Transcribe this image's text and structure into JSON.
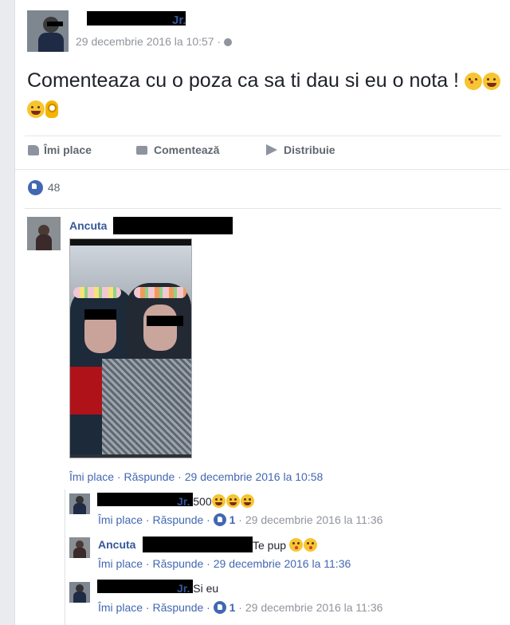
{
  "post": {
    "author_suffix": "Jr.",
    "timestamp": "29 decembrie 2016 la 10:57 · ",
    "text": "Comenteaza cu o poza ca sa ti dau si eu o nota ! ",
    "actions": {
      "like": "Îmi place",
      "comment": "Comentează",
      "share": "Distribuie"
    },
    "reaction_count": "48"
  },
  "comments": [
    {
      "author": "Ancuta",
      "text": "",
      "actions": "Îmi place · Răspunde · 29 decembrie 2016 la 10:58",
      "has_photo": true
    }
  ],
  "replies": [
    {
      "author_suffix": "Jr.",
      "text": " 500",
      "actions_prefix": "Îmi place · Răspunde · ",
      "likes": "1",
      "actions_suffix": " · 29 decembrie 2016 la 11:36"
    },
    {
      "author": "Ancuta",
      "text": " Te pup ",
      "actions": "Îmi place · Răspunde · 29 decembrie 2016 la 11:36"
    },
    {
      "author_suffix": "Jr.",
      "text": " Si eu",
      "actions_prefix": "Îmi place · Răspunde · ",
      "likes": "1",
      "actions_suffix": " · 29 decembrie 2016 la 11:36"
    }
  ],
  "colors": {
    "link": "#365899",
    "meta": "#90949c",
    "like_blue": "#4267b2"
  }
}
